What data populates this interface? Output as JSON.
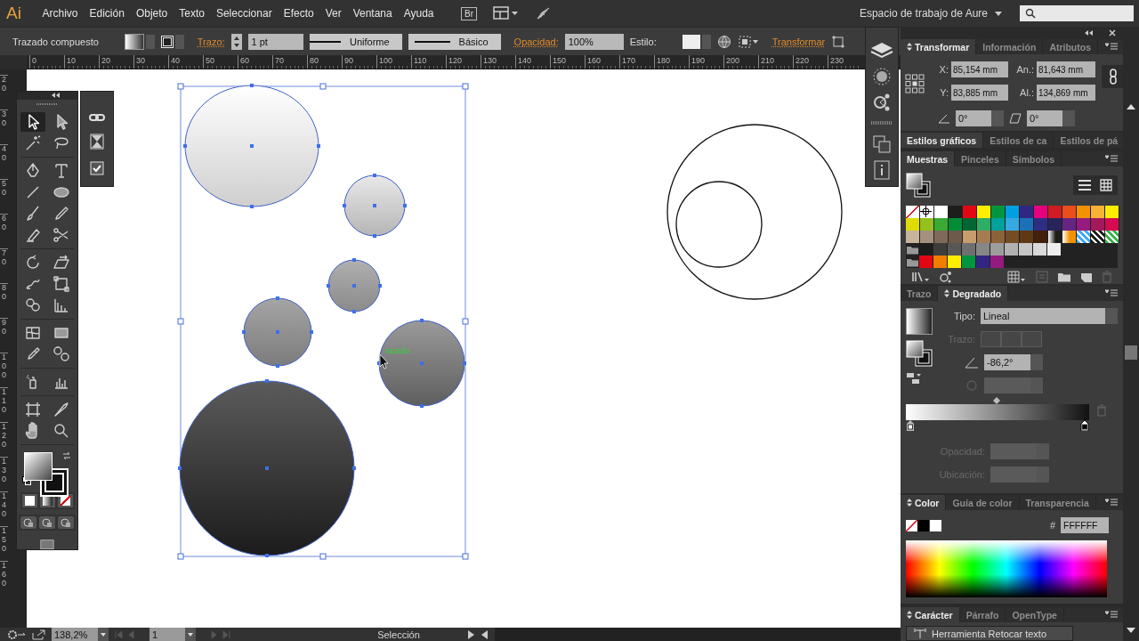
{
  "menu_bar": {
    "logo": "Ai",
    "items": [
      "Archivo",
      "Edición",
      "Objeto",
      "Texto",
      "Seleccionar",
      "Efecto",
      "Ver",
      "Ventana",
      "Ayuda"
    ],
    "bridge": "Br",
    "workspace": "Espacio de trabajo de Aure"
  },
  "control_bar": {
    "selection": "Trazado compuesto",
    "stroke_label": "Trazo:",
    "stroke_weight": "1 pt",
    "profile": "Uniforme",
    "brush": "Básico",
    "opacity_label": "Opacidad:",
    "opacity": "100%",
    "style_label": "Estilo:",
    "transform_link": "Transformar"
  },
  "rulers": {
    "horizontal": [
      "0",
      "10",
      "20",
      "30",
      "40",
      "50",
      "60",
      "70",
      "80",
      "90",
      "100",
      "110",
      "120",
      "130",
      "140",
      "150",
      "160",
      "170",
      "180",
      "190",
      "200",
      "210",
      "220",
      "230"
    ],
    "vertical": [
      "20",
      "30",
      "40",
      "50",
      "60",
      "70",
      "80",
      "90",
      "100",
      "110",
      "120",
      "130",
      "140",
      "150",
      "160"
    ]
  },
  "canvas": {
    "smart_guide": "razado"
  },
  "tool_groups": [
    [
      {
        "kind": "arrow",
        "selected": true
      },
      {
        "kind": "filled-arrow",
        "selected": false
      },
      {
        "kind": "wand",
        "selected": false
      },
      {
        "kind": "lasso",
        "selected": false
      }
    ],
    [
      {
        "kind": "pen-nib",
        "selected": false
      },
      {
        "kind": "letter-t",
        "selected": false
      },
      {
        "kind": "line",
        "selected": false
      },
      {
        "kind": "ellipse",
        "selected": false
      },
      {
        "kind": "brush",
        "selected": false
      },
      {
        "kind": "pencil",
        "selected": false
      },
      {
        "kind": "eraser",
        "selected": false
      },
      {
        "kind": "scissors",
        "selected": false
      }
    ],
    [
      {
        "kind": "rotate",
        "selected": false
      },
      {
        "kind": "shear",
        "selected": false
      },
      {
        "kind": "warp",
        "selected": false
      },
      {
        "kind": "free-transform",
        "selected": false
      },
      {
        "kind": "shape-builder",
        "selected": false
      },
      {
        "kind": "perspective-grid",
        "selected": false
      }
    ],
    [
      {
        "kind": "mesh",
        "selected": false
      },
      {
        "kind": "gradient",
        "selected": false
      },
      {
        "kind": "eyedropper",
        "selected": false
      },
      {
        "kind": "blend",
        "selected": false
      }
    ],
    [
      {
        "kind": "sprayer",
        "selected": false
      },
      {
        "kind": "column-graph",
        "selected": false
      }
    ],
    [
      {
        "kind": "artboard",
        "selected": false
      },
      {
        "kind": "knife",
        "selected": false
      },
      {
        "kind": "hand",
        "selected": false
      },
      {
        "kind": "magnifier",
        "selected": false
      }
    ]
  ],
  "transform_panel": {
    "tabs": [
      {
        "label": "Transformar",
        "selected": true
      },
      {
        "label": "Información",
        "selected": false
      },
      {
        "label": "Atributos",
        "selected": false
      }
    ],
    "fields": [
      {
        "label": "X:",
        "value": "85,154 mm"
      },
      {
        "label": "An.:",
        "value": "81,643 mm"
      },
      {
        "label": "Y:",
        "value": "83,885 mm"
      },
      {
        "label": "Al.:",
        "value": "134,869 mm"
      }
    ],
    "rotate": "0°",
    "shear": "0°"
  },
  "styles_panel": {
    "tabs": [
      {
        "label": "Estilos gráficos",
        "selected": true
      },
      {
        "label": "Estilos de ca",
        "selected": false
      },
      {
        "label": "Estilos de pá",
        "selected": false
      }
    ]
  },
  "swatches_panel": {
    "tabs": [
      {
        "label": "Muestras",
        "selected": true
      },
      {
        "label": "Pinceles",
        "selected": false
      },
      {
        "label": "Símbolos",
        "selected": false
      }
    ],
    "rows": [
      [
        {
          "kind": "none"
        },
        {
          "kind": "register"
        },
        {
          "kind": "color",
          "color": "#ffffff"
        },
        {
          "kind": "color",
          "color": "#1d1d1b"
        },
        {
          "kind": "color",
          "color": "#e30613"
        },
        {
          "kind": "color",
          "color": "#ffed00"
        },
        {
          "kind": "color",
          "color": "#009640"
        },
        {
          "kind": "color",
          "color": "#009fe3"
        },
        {
          "kind": "color",
          "color": "#312783"
        },
        {
          "kind": "color",
          "color": "#e6007e"
        },
        {
          "kind": "color",
          "color": "#cf1c24"
        },
        {
          "kind": "color",
          "color": "#e94e1b"
        },
        {
          "kind": "color",
          "color": "#f39200"
        },
        {
          "kind": "color",
          "color": "#f9b233"
        },
        {
          "kind": "color",
          "color": "#ffed00"
        }
      ],
      [
        {
          "kind": "color",
          "color": "#dedc00"
        },
        {
          "kind": "color",
          "color": "#95c11f"
        },
        {
          "kind": "color",
          "color": "#3aaa35"
        },
        {
          "kind": "color",
          "color": "#008d36"
        },
        {
          "kind": "color",
          "color": "#006633"
        },
        {
          "kind": "color",
          "color": "#2fac66"
        },
        {
          "kind": "color",
          "color": "#00a19a"
        },
        {
          "kind": "color",
          "color": "#36a9e1"
        },
        {
          "kind": "color",
          "color": "#1d71b8"
        },
        {
          "kind": "color",
          "color": "#2d2e83"
        },
        {
          "kind": "color",
          "color": "#29235c"
        },
        {
          "kind": "color",
          "color": "#662483"
        },
        {
          "kind": "color",
          "color": "#951b81"
        },
        {
          "kind": "color",
          "color": "#a3195b"
        },
        {
          "kind": "color",
          "color": "#d60b52"
        }
      ],
      [
        {
          "kind": "color",
          "color": "#c8b39d"
        },
        {
          "kind": "color",
          "color": "#a3907e"
        },
        {
          "kind": "color",
          "color": "#7f6a5a"
        },
        {
          "kind": "color",
          "color": "#6c5a4a"
        },
        {
          "kind": "color",
          "color": "#c69c6d"
        },
        {
          "kind": "color",
          "color": "#a67c52"
        },
        {
          "kind": "color",
          "color": "#8c6239"
        },
        {
          "kind": "color",
          "color": "#754c24"
        },
        {
          "kind": "color",
          "color": "#603813"
        },
        {
          "kind": "color",
          "color": "#42210b"
        },
        {
          "kind": "gradient",
          "color": "#1d1d1b"
        },
        {
          "kind": "gradient",
          "color": "#f39200"
        },
        {
          "kind": "pattern",
          "color": "#3fa9f5"
        },
        {
          "kind": "pattern",
          "color": "#1d1d1b"
        },
        {
          "kind": "pattern",
          "color": "#39b54a"
        }
      ],
      [
        {
          "kind": "folder"
        },
        {
          "kind": "color",
          "color": "#1d1d1b"
        },
        {
          "kind": "color",
          "color": "#3c3c3b"
        },
        {
          "kind": "color",
          "color": "#575756"
        },
        {
          "kind": "color",
          "color": "#706f6f"
        },
        {
          "kind": "color",
          "color": "#878787"
        },
        {
          "kind": "color",
          "color": "#9d9d9c"
        },
        {
          "kind": "color",
          "color": "#b2b2b2"
        },
        {
          "kind": "color",
          "color": "#c6c6c6"
        },
        {
          "kind": "color",
          "color": "#dadada"
        },
        {
          "kind": "color",
          "color": "#ededed"
        }
      ],
      [
        {
          "kind": "folder"
        },
        {
          "kind": "color",
          "color": "#e30613"
        },
        {
          "kind": "color",
          "color": "#f07d00"
        },
        {
          "kind": "color",
          "color": "#ffed00"
        },
        {
          "kind": "color",
          "color": "#009640"
        },
        {
          "kind": "color",
          "color": "#312783"
        },
        {
          "kind": "color",
          "color": "#951b81"
        }
      ]
    ]
  },
  "gradient_panel": {
    "tabs": [
      {
        "label": "Trazo",
        "selected": false
      },
      {
        "label": "Degradado",
        "selected": true
      }
    ],
    "type_label": "Tipo:",
    "type": "Lineal",
    "stops": [
      {
        "selected": false
      },
      {
        "selected": true
      }
    ],
    "stroke": {
      "label": "Trazo:",
      "disabled": true
    },
    "angle": "-86,2°",
    "opacity": {
      "label": "Opacidad:",
      "disabled": true
    },
    "location": {
      "label": "Ubicación:",
      "disabled": true
    }
  },
  "color_panel": {
    "tabs": [
      {
        "label": "Color",
        "selected": true
      },
      {
        "label": "Guía de color",
        "selected": false
      },
      {
        "label": "Transparencia",
        "selected": false
      }
    ],
    "hex_label": "#",
    "hex": "FFFFFF"
  },
  "character_panel": {
    "tabs": [
      {
        "label": "Carácter",
        "selected": true
      },
      {
        "label": "Párrafo",
        "selected": false
      },
      {
        "label": "OpenType",
        "selected": false
      }
    ],
    "button": "Herramienta Retocar texto"
  },
  "status_bar": {
    "zoom": "138,2%",
    "artboard": "1",
    "tool": "Selección"
  }
}
